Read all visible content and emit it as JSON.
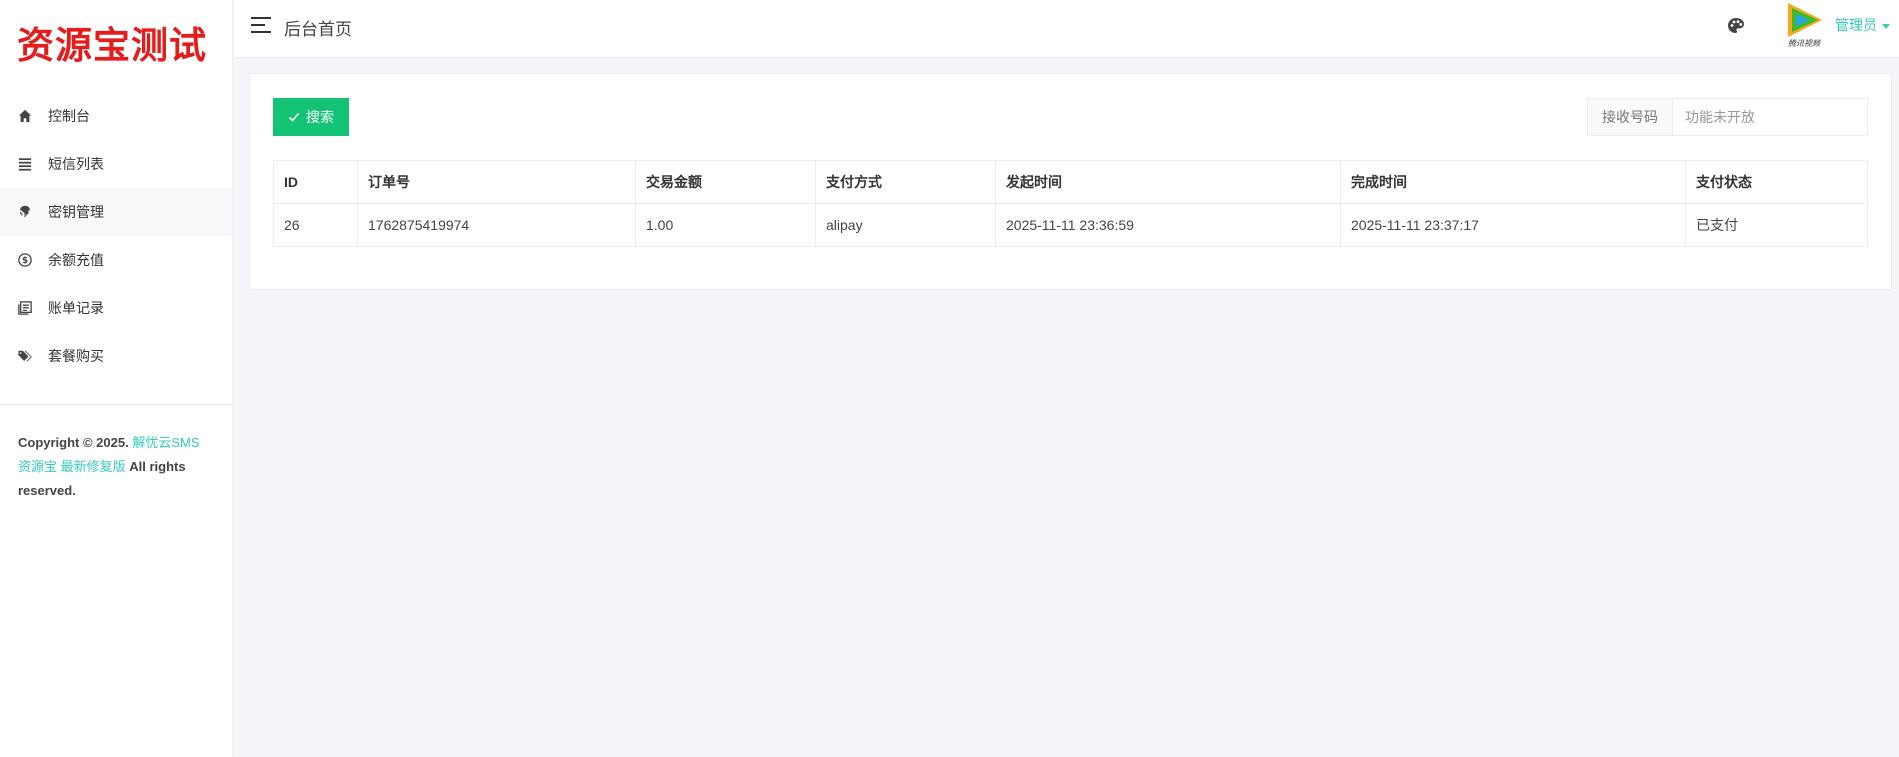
{
  "sidebar": {
    "logo": "资源宝测试",
    "items": [
      {
        "label": "控制台",
        "icon": "home-icon"
      },
      {
        "label": "短信列表",
        "icon": "list-icon"
      },
      {
        "label": "密钥管理",
        "icon": "fingerprint-icon"
      },
      {
        "label": "余额充值",
        "icon": "dollar-circle-icon"
      },
      {
        "label": "账单记录",
        "icon": "bill-icon"
      },
      {
        "label": "套餐购买",
        "icon": "tags-icon"
      }
    ],
    "copyright": {
      "prefix": "Copyright © 2025.",
      "link1": "解忧云SMS",
      "link2": "资源宝 最新修复版",
      "suffix": "All rights reserved."
    }
  },
  "header": {
    "title": "后台首页",
    "user": "管理员",
    "avatar_text": "腾讯视频"
  },
  "toolbar": {
    "search_label": "搜索",
    "phone_label": "接收号码",
    "phone_placeholder": "功能未开放",
    "phone_value": ""
  },
  "table": {
    "columns": [
      "ID",
      "订单号",
      "交易金额",
      "支付方式",
      "发起时间",
      "完成时间",
      "支付状态"
    ],
    "rows": [
      {
        "id": "26",
        "order_no": "1762875419974",
        "amount": "1.00",
        "method": "alipay",
        "start_time": "2025-11-11 23:36:59",
        "end_time": "2025-11-11 23:37:17",
        "status": "已支付"
      }
    ]
  },
  "colors": {
    "accent": "#33cabb",
    "success": "#15c377",
    "logo": "#e41c1c"
  }
}
